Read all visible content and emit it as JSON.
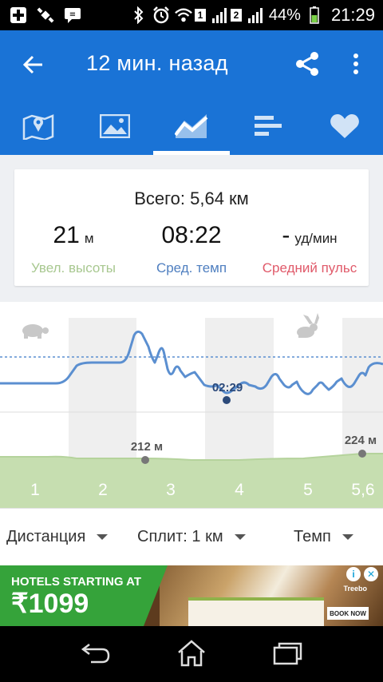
{
  "status_bar": {
    "battery_percent": "44%",
    "time": "21:29",
    "sim1": "1",
    "sim2": "2"
  },
  "app_bar": {
    "title": "12 мин. назад",
    "tabs": [
      {
        "name": "map",
        "icon": "map-icon",
        "active": false
      },
      {
        "name": "photos",
        "icon": "image-icon",
        "active": false
      },
      {
        "name": "charts",
        "icon": "chart-icon",
        "active": true
      },
      {
        "name": "splits",
        "icon": "bars-icon",
        "active": false
      },
      {
        "name": "heart",
        "icon": "heart-icon",
        "active": false
      }
    ]
  },
  "summary": {
    "total": "Всего: 5,64 км",
    "elevation_value": "21",
    "elevation_unit": "м",
    "elevation_label": "Увел. высоты",
    "pace_value": "08:22",
    "pace_label": "Сред. темп",
    "hr_value": "-",
    "hr_unit": "уд/мин",
    "hr_label": "Средний пульс"
  },
  "colors": {
    "primary": "#1a73d6",
    "elevation_label": "#a8c890",
    "pace_label": "#4f7fc0",
    "hr_label": "#e05a6a",
    "pace_line": "#5b8fd0",
    "elevation_fill": "#c6deb0"
  },
  "chart": {
    "min_pace_label": "02:29",
    "elevation_min_label": "212 м",
    "elevation_max_label": "224 м",
    "km_labels": [
      "1",
      "2",
      "3",
      "4",
      "5",
      "5,6"
    ]
  },
  "filters": {
    "distance": "Дистанция",
    "split": "Сплит: 1 км",
    "pace": "Темп"
  },
  "ad": {
    "line1": "HOTELS STARTING AT",
    "line2": "₹1099",
    "button": "BOOK NOW",
    "brand": "Treebo"
  }
}
